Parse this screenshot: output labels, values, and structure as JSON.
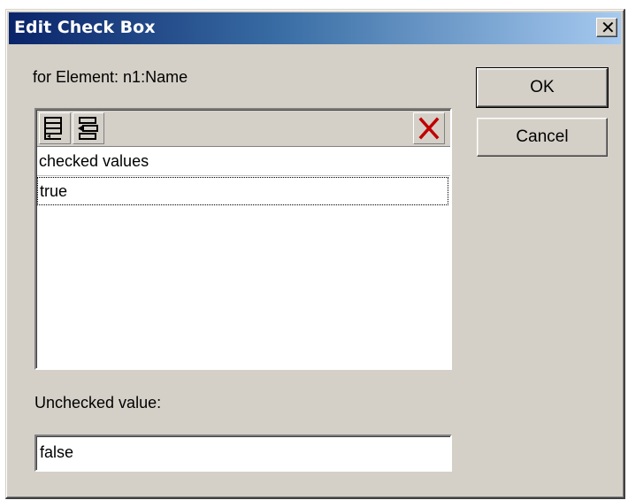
{
  "window": {
    "title": "Edit Check Box",
    "close_glyph": "✕"
  },
  "labels": {
    "for_element": "for Element: n1:Name",
    "unchecked_value": "Unchecked value:"
  },
  "buttons": {
    "ok": "OK",
    "cancel": "Cancel"
  },
  "toolbar": {
    "icons": [
      "append-row-icon",
      "insert-row-icon",
      "delete-row-icon"
    ],
    "delete_color": "#c00000"
  },
  "list": {
    "header": "checked values",
    "rows": [
      "true"
    ]
  },
  "unchecked_input": {
    "value": "false"
  }
}
